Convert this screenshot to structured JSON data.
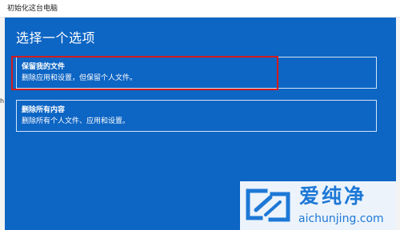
{
  "window": {
    "title": "初始化这台电脑"
  },
  "stray_text": "h",
  "dialog": {
    "heading": "选择一个选项",
    "options": [
      {
        "title": "保留我的文件",
        "description": "删除应用和设置，但保留个人文件。"
      },
      {
        "title": "删除所有内容",
        "description": "删除所有个人文件、应用和设置。"
      }
    ]
  },
  "watermark": {
    "site_name": "爱纯净",
    "url": "aichunjing.com",
    "logo_icon": "aichunjing-logo-icon"
  },
  "colors": {
    "panel_bg": "#0d65c4",
    "highlight": "#d21b1b",
    "watermark_text": "#1d78d6"
  }
}
